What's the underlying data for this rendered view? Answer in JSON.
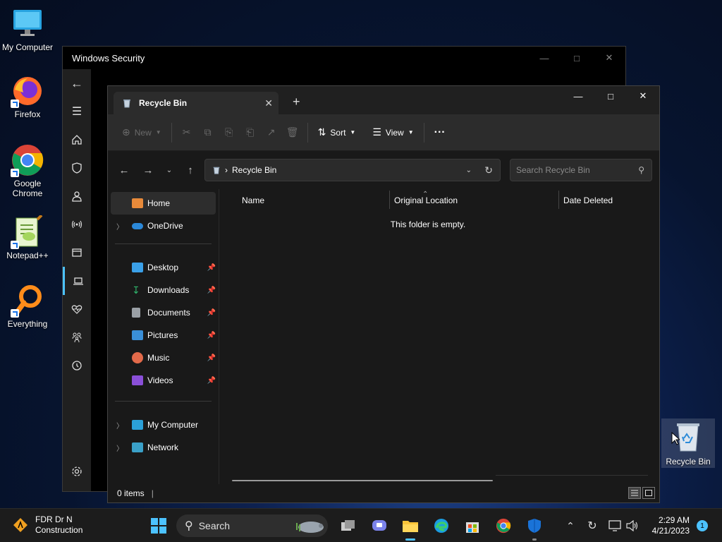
{
  "desktop": {
    "icons": [
      {
        "label": "My Computer",
        "icon": "monitor-icon"
      },
      {
        "label": "Firefox",
        "icon": "firefox-icon"
      },
      {
        "label": "Google Chrome",
        "icon": "chrome-icon"
      },
      {
        "label": "Notepad++",
        "icon": "notepadpp-icon"
      },
      {
        "label": "Everything",
        "icon": "everything-search-icon"
      }
    ],
    "recycle_bin_label": "Recycle Bin"
  },
  "security_window": {
    "title": "Windows Security",
    "rail_icons": [
      "back-arrow-icon",
      "hamburger-menu-icon",
      "home-icon",
      "shield-icon",
      "person-icon",
      "wifi-antenna-icon",
      "app-browser-icon",
      "laptop-icon",
      "health-heart-icon",
      "family-icon",
      "history-icon",
      "settings-gear-icon"
    ]
  },
  "explorer": {
    "tab_title": "Recycle Bin",
    "toolbar": {
      "new_label": "New",
      "sort_label": "Sort",
      "view_label": "View",
      "more_label": "···"
    },
    "address": {
      "path": "Recycle Bin",
      "search_placeholder": "Search Recycle Bin"
    },
    "nav_pane": {
      "home": "Home",
      "onedrive": "OneDrive",
      "quick_access": [
        {
          "label": "Desktop",
          "icon": "desktop-folder-icon",
          "color": "#3aa0e8"
        },
        {
          "label": "Downloads",
          "icon": "download-arrow-icon",
          "color": "#2fb36b"
        },
        {
          "label": "Documents",
          "icon": "document-icon",
          "color": "#9aa0a6"
        },
        {
          "label": "Pictures",
          "icon": "pictures-icon",
          "color": "#3a8fd8"
        },
        {
          "label": "Music",
          "icon": "music-icon",
          "color": "#e26a4a"
        },
        {
          "label": "Videos",
          "icon": "videos-icon",
          "color": "#8a4fd8"
        }
      ],
      "my_computer": "My Computer",
      "network": "Network"
    },
    "columns": [
      "Name",
      "Original Location",
      "Date Deleted"
    ],
    "empty_message": "This folder is empty.",
    "status": {
      "item_count": "0 items"
    }
  },
  "taskbar": {
    "weather": {
      "line1": "FDR Dr N",
      "line2": "Construction"
    },
    "search_label": "Search",
    "clock": {
      "time": "2:29 AM",
      "date": "4/21/2023"
    },
    "notification_count": "1"
  },
  "colors": {
    "accent": "#4cc2ff",
    "window_bg": "#191919",
    "cmdbar_bg": "#2c2c2c"
  }
}
